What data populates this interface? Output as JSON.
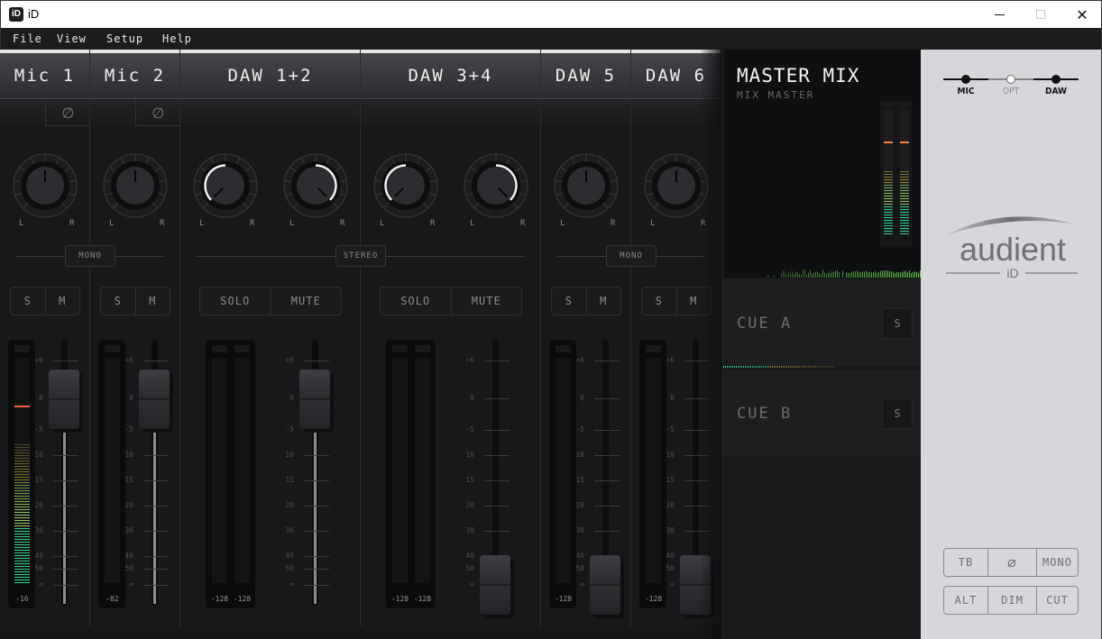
{
  "window": {
    "title": "iD",
    "app_icon": "iD"
  },
  "menu": [
    "File",
    "View",
    "Setup",
    "Help"
  ],
  "colors": {
    "meter_green": "#2fd08a",
    "meter_yellow": "#c8b03a",
    "peak": "#f06040",
    "master_peak": "#f08a3a",
    "wave_green": "#6ac850"
  },
  "channels": [
    {
      "name": "Mic 1",
      "type": "mono",
      "mode_label": "MONO",
      "phase": true,
      "pans": [
        0
      ],
      "pan_labels": [
        "L",
        "R"
      ],
      "solo": "S",
      "mute": "M",
      "meter_values": [
        "-16"
      ],
      "meter_levels": [
        0.62
      ],
      "peak_hold": [
        0.78
      ],
      "fader_db": "0"
    },
    {
      "name": "Mic 2",
      "type": "mono",
      "mode_label": "MONO",
      "phase": true,
      "pans": [
        0
      ],
      "pan_labels": [
        "L",
        "R"
      ],
      "solo": "S",
      "mute": "M",
      "meter_values": [
        "-82"
      ],
      "meter_levels": [
        0
      ],
      "peak_hold": [
        null
      ],
      "fader_db": "0"
    },
    {
      "name": "DAW 1+2",
      "type": "stereo",
      "mode_label": "STEREO",
      "phase": false,
      "pans": [
        -1,
        1
      ],
      "pan_labels": [
        "L",
        "R"
      ],
      "solo": "SOLO",
      "mute": "MUTE",
      "meter_values": [
        "-128",
        "-128"
      ],
      "meter_levels": [
        0,
        0
      ],
      "peak_hold": [
        null,
        null
      ],
      "fader_db": "0"
    },
    {
      "name": "DAW 3+4",
      "type": "stereo",
      "mode_label": "STEREO",
      "phase": false,
      "pans": [
        -1,
        1
      ],
      "pan_labels": [
        "L",
        "R"
      ],
      "solo": "SOLO",
      "mute": "MUTE",
      "meter_values": [
        "-128",
        "-128"
      ],
      "meter_levels": [
        0,
        0
      ],
      "peak_hold": [
        null,
        null
      ],
      "fader_db": "-inf"
    },
    {
      "name": "DAW 5",
      "type": "mono",
      "mode_label": "MONO",
      "phase": false,
      "pans": [
        0
      ],
      "pan_labels": [
        "L",
        "R"
      ],
      "solo": "S",
      "mute": "M",
      "meter_values": [
        "-128"
      ],
      "meter_levels": [
        0
      ],
      "peak_hold": [
        null
      ],
      "fader_db": "-inf"
    },
    {
      "name": "DAW 6",
      "type": "mono",
      "mode_label": "MONO",
      "phase": false,
      "pans": [
        0
      ],
      "pan_labels": [
        "L",
        "R"
      ],
      "solo": "S",
      "mute": "M",
      "meter_values": [
        "-128"
      ],
      "meter_levels": [
        0
      ],
      "peak_hold": [
        null
      ],
      "fader_db": "-inf"
    }
  ],
  "fader_scale": [
    "+6",
    "0",
    "-5",
    "10",
    "15",
    "20",
    "30",
    "40",
    "50",
    "∞"
  ],
  "phase_symbol": "∅",
  "master": {
    "title": "MASTER MIX",
    "subtitle": "MIX MASTER",
    "meter_levels": [
      0.52,
      0.52
    ],
    "peak_hold": [
      0.73,
      0.73
    ]
  },
  "cues": [
    {
      "name": "CUE A",
      "solo": "S"
    },
    {
      "name": "CUE B",
      "solo": "S"
    }
  ],
  "source": {
    "options": [
      "MIC",
      "OPT",
      "DAW"
    ],
    "active": [
      "MIC",
      "DAW"
    ]
  },
  "logo": {
    "brand": "audient",
    "model": "iD"
  },
  "controls": {
    "row1": [
      "TB",
      "∅",
      "MONO"
    ],
    "row2": [
      "ALT",
      "DIM",
      "CUT"
    ]
  }
}
